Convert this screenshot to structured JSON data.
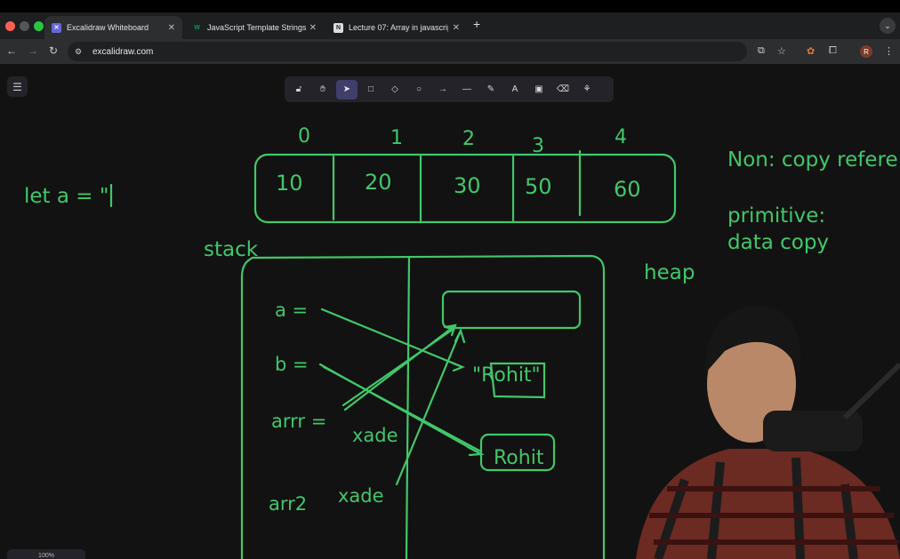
{
  "tabs": [
    {
      "title": "Excalidraw Whiteboard",
      "active": true
    },
    {
      "title": "JavaScript Template Strings",
      "active": false
    },
    {
      "title": "Lecture 07: Array in javascrip",
      "active": false
    }
  ],
  "address_bar": {
    "url": "excalidraw.com"
  },
  "profile_initial": "R",
  "zoom_label": "100%",
  "drawing": {
    "indices": [
      "0",
      "1",
      "2",
      "3",
      "4"
    ],
    "array_values": [
      "10",
      "20",
      "30",
      "50",
      "60"
    ],
    "left_text": "let a = \"",
    "stack_label": "stack",
    "heap_label": "heap",
    "non_primitive_note": "Non: copy refere",
    "primitive_note_line1": "primitive:",
    "primitive_note_line2": "data copy",
    "var_a": "a =",
    "var_b": "b =",
    "var_arrr": "arrr =",
    "var_arr2": "arr2",
    "address_1": "xade",
    "address_2": "xade",
    "heap_value_1": "\"Rohit\"",
    "heap_value_2": "Rohit"
  },
  "colors": {
    "ink": "#42c76a",
    "canvas": "#121212",
    "toolbar_selected": "#403e6a"
  },
  "icons": [
    "lock-icon",
    "hand-icon",
    "pointer-icon",
    "rectangle-icon",
    "diamond-icon",
    "ellipse-icon",
    "arrow-icon",
    "line-icon",
    "pencil-icon",
    "text-icon",
    "image-icon",
    "eraser-icon",
    "library-icon"
  ]
}
